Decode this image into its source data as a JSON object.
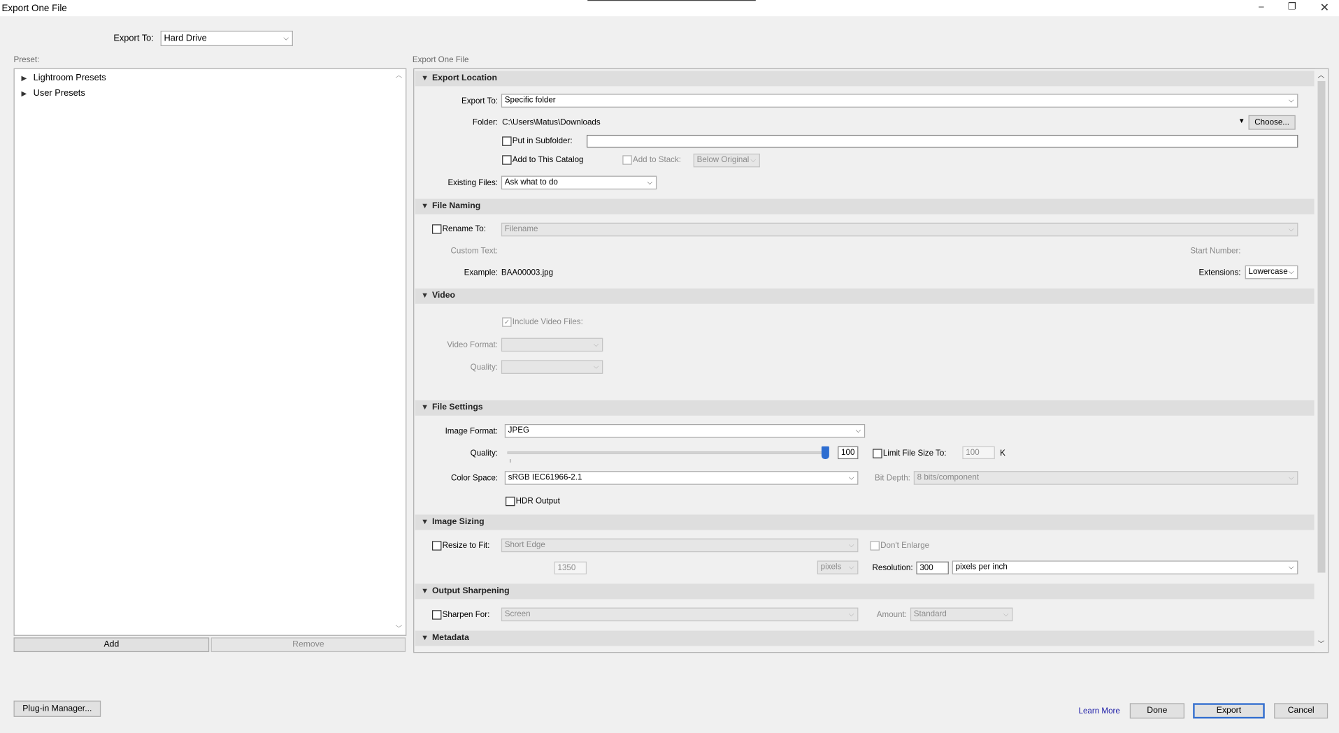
{
  "window": {
    "title": "Export One File"
  },
  "top": {
    "export_to_label": "Export To:",
    "export_to_value": "Hard Drive"
  },
  "left": {
    "preset_label": "Preset:",
    "tree": [
      {
        "label": "Lightroom Presets"
      },
      {
        "label": "User Presets"
      }
    ],
    "add_label": "Add",
    "remove_label": "Remove"
  },
  "right": {
    "caption": "Export One File"
  },
  "export_location": {
    "title": "Export Location",
    "export_to_label": "Export To:",
    "export_to_value": "Specific folder",
    "folder_label": "Folder:",
    "folder_value": "C:\\Users\\Matus\\Downloads",
    "choose_label": "Choose...",
    "subfolder_label": "Put in Subfolder:",
    "subfolder_value": "",
    "add_catalog_label": "Add to This Catalog",
    "add_stack_label": "Add to Stack:",
    "stack_value": "Below Original",
    "existing_label": "Existing Files:",
    "existing_value": "Ask what to do"
  },
  "file_naming": {
    "title": "File Naming",
    "rename_label": "Rename To:",
    "rename_value": "Filename",
    "custom_text_label": "Custom Text:",
    "start_number_label": "Start Number:",
    "example_label": "Example:",
    "example_value": "BAA00003.jpg",
    "extensions_label": "Extensions:",
    "extensions_value": "Lowercase"
  },
  "video": {
    "title": "Video",
    "include_label": "Include Video Files:",
    "format_label": "Video Format:",
    "quality_label": "Quality:"
  },
  "file_settings": {
    "title": "File Settings",
    "format_label": "Image Format:",
    "format_value": "JPEG",
    "quality_label": "Quality:",
    "quality_value": "100",
    "quality_fraction": 1.0,
    "limit_label": "Limit File Size To:",
    "limit_value": "100",
    "limit_unit": "K",
    "colorspace_label": "Color Space:",
    "colorspace_value": "sRGB IEC61966-2.1",
    "bitdepth_label": "Bit Depth:",
    "bitdepth_value": "8 bits/component",
    "hdr_label": "HDR Output"
  },
  "image_sizing": {
    "title": "Image Sizing",
    "resize_label": "Resize to Fit:",
    "resize_value": "Short Edge",
    "dont_enlarge_label": "Don't Enlarge",
    "size_value": "1350",
    "units_value": "pixels",
    "resolution_label": "Resolution:",
    "resolution_value": "300",
    "resolution_unit": "pixels per inch"
  },
  "output_sharpening": {
    "title": "Output Sharpening",
    "sharpen_label": "Sharpen For:",
    "sharpen_value": "Screen",
    "amount_label": "Amount:",
    "amount_value": "Standard"
  },
  "metadata": {
    "title": "Metadata"
  },
  "footer": {
    "plugin_label": "Plug-in Manager...",
    "learn_more": "Learn More",
    "done_label": "Done",
    "export_label": "Export",
    "cancel_label": "Cancel"
  },
  "colors": {
    "link": "#1a1aa6",
    "slider_thumb": "#2d6dd1",
    "default_border": "#2f6ccf"
  }
}
